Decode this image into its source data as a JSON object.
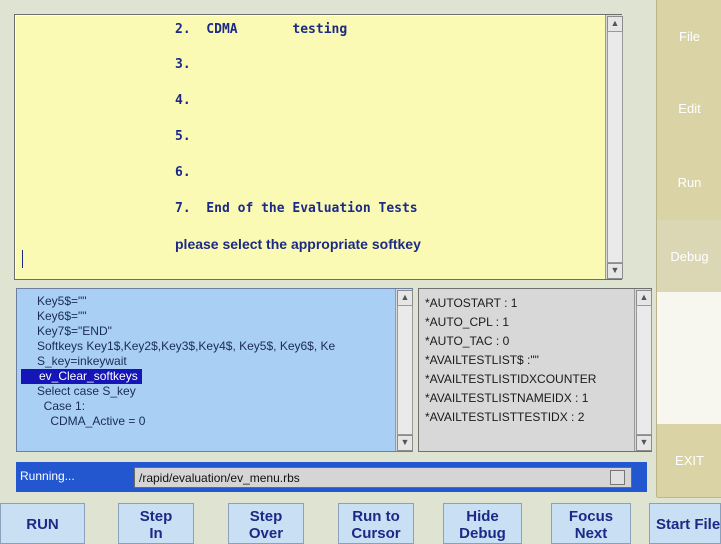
{
  "output": {
    "lines": [
      "2.  CDMA       testing",
      "3.",
      "4.",
      "5.",
      "6.",
      "7.  End of the Evaluation Tests"
    ],
    "prompt": "please select the appropriate softkey"
  },
  "code": {
    "lines": [
      "Key5$=\"\"",
      "Key6$=\"\"",
      "Key7$=\"END\"",
      "Softkeys Key1$,Key2$,Key3$,Key4$, Key5$, Key6$, Kе",
      "S_key=inkeywait",
      "ev_Clear_softkeys",
      "Select case S_key",
      "  Case 1:",
      "    CDMA_Active = 0"
    ],
    "highlighted_index": 5
  },
  "vars": {
    "lines": [
      "*AUTOSTART : 1",
      "*AUTO_CPL : 1",
      "*AUTO_TAC : 0",
      "*AVAILTESTLIST$ :\"\"",
      "*AVAILTESTLISTIDXCOUNTER",
      "*AVAILTESTLISTNAMEIDX : 1",
      "*AVAILTESTLISTTESTIDX : 2"
    ]
  },
  "status": {
    "label": "Running...",
    "file_path": "/rapid/evaluation/ev_menu.rbs"
  },
  "buttons": {
    "run": "RUN",
    "step_in_1": "Step",
    "step_in_2": "In",
    "step_over_1": "Step",
    "step_over_2": "Over",
    "run_to_cursor_1": "Run to",
    "run_to_cursor_2": "Cursor",
    "hide_debug_1": "Hide",
    "hide_debug_2": "Debug",
    "focus_next_1": "Focus",
    "focus_next_2": "Next",
    "start_file": "Start File"
  },
  "softkeys": {
    "file": "File",
    "edit": "Edit",
    "run": "Run",
    "debug": "Debug",
    "exit": "EXIT"
  },
  "colors": {
    "output_bg": "#fbfab4",
    "code_bg": "#a9d0f4",
    "status_bg": "#2357cf",
    "highlight": "#1616b8",
    "text_blue": "#1b2a86"
  }
}
